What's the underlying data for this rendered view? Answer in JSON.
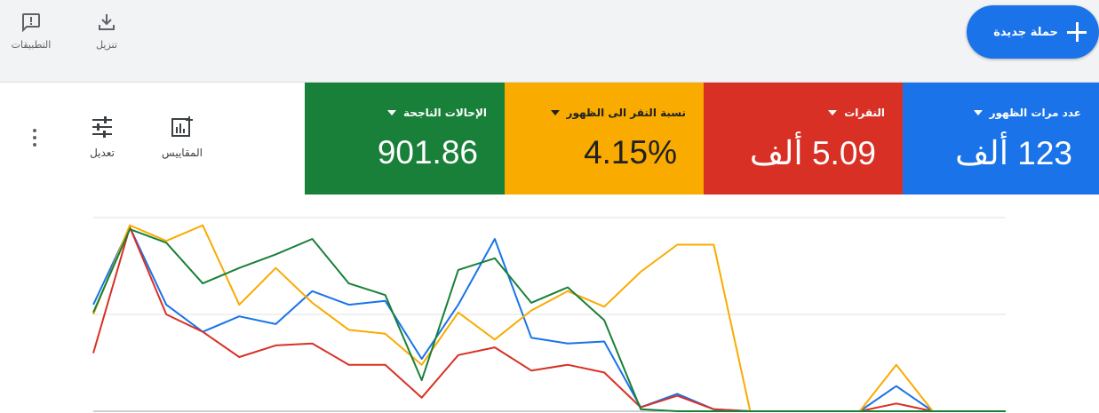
{
  "toolbar": {
    "apps_label": "التطبيقات",
    "download_label": "تنزيل",
    "new_campaign_label": "حملة جديدة"
  },
  "metrics": [
    {
      "label": "عدد مرات الظهور",
      "value": "123 ألف",
      "color": "#1a73e8"
    },
    {
      "label": "النقرات",
      "value": "5.09 ألف",
      "color": "#d93025"
    },
    {
      "label": "نسبة النقر الى الظهور",
      "value": "4.15%",
      "color": "#f9ab00"
    },
    {
      "label": "الإحالات الناجحة",
      "value": "901.86",
      "color": "#188038"
    }
  ],
  "panel_tools": {
    "metrics_label": "المقاييس",
    "adjust_label": "تعديل"
  },
  "chart_data": {
    "type": "line",
    "x": [
      0,
      1,
      2,
      3,
      4,
      5,
      6,
      7,
      8,
      9,
      10,
      11,
      12,
      13,
      14,
      15,
      16,
      17,
      18,
      19,
      20,
      21,
      22,
      23,
      24,
      25
    ],
    "ylim": [
      0,
      100
    ],
    "grid": true,
    "series": [
      {
        "color": "#1a73e8",
        "values": [
          55,
          95,
          55,
          41,
          49,
          45,
          62,
          55,
          57,
          27,
          55,
          89,
          38,
          35,
          36,
          2,
          9,
          1,
          0,
          0,
          0,
          0,
          13,
          0,
          0,
          0
        ]
      },
      {
        "color": "#d93025",
        "values": [
          30,
          95,
          50,
          41,
          28,
          34,
          35,
          24,
          24,
          7,
          29,
          33,
          21,
          24,
          20,
          2,
          8,
          1,
          0,
          0,
          0,
          0,
          4,
          0,
          0,
          0
        ]
      },
      {
        "color": "#f9ab00",
        "values": [
          50,
          96,
          88,
          96,
          55,
          74,
          56,
          42,
          40,
          24,
          51,
          37,
          52,
          62,
          54,
          72,
          86,
          86,
          0,
          0,
          0,
          0,
          24,
          0,
          0,
          0
        ]
      },
      {
        "color": "#188038",
        "values": [
          51,
          94,
          87,
          66,
          74,
          81,
          89,
          66,
          60,
          16,
          73,
          79,
          56,
          64,
          47,
          1,
          0,
          0,
          0,
          0,
          0,
          0,
          0,
          0,
          0,
          0
        ]
      }
    ]
  }
}
